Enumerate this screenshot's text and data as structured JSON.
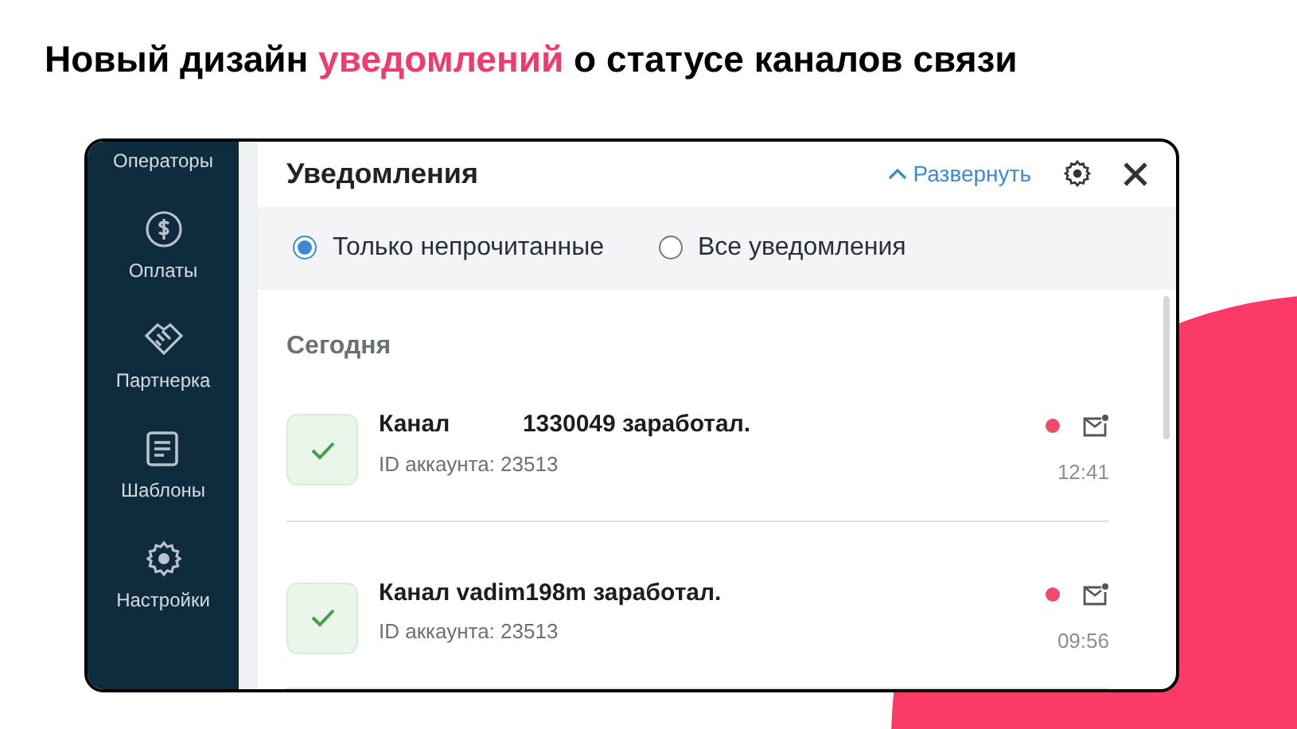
{
  "slide_title": [
    {
      "text": "Новый дизайн",
      "highlight": false
    },
    {
      "text": "уведомлений",
      "highlight": true
    },
    {
      "text": "о статусе каналов связи",
      "highlight": false
    }
  ],
  "sidebar": {
    "items": [
      {
        "label": "Операторы"
      },
      {
        "label": "Оплаты"
      },
      {
        "label": "Партнерка"
      },
      {
        "label": "Шаблоны"
      },
      {
        "label": "Настройки"
      }
    ]
  },
  "panel": {
    "title": "Уведомления",
    "expand_link": "Развернуть",
    "filters": [
      {
        "label": "Только непрочитанные",
        "selected": true
      },
      {
        "label": "Все уведомления",
        "selected": false
      }
    ],
    "section": "Сегодня",
    "notifications": [
      {
        "title": "Канал           1330049 заработал.",
        "subtitle": "ID аккаунта: 23513",
        "time": "12:41",
        "unread": true
      },
      {
        "title": "Канал vadim198m заработал.",
        "subtitle": "ID аккаунта: 23513",
        "time": "09:56",
        "unread": true
      }
    ]
  }
}
